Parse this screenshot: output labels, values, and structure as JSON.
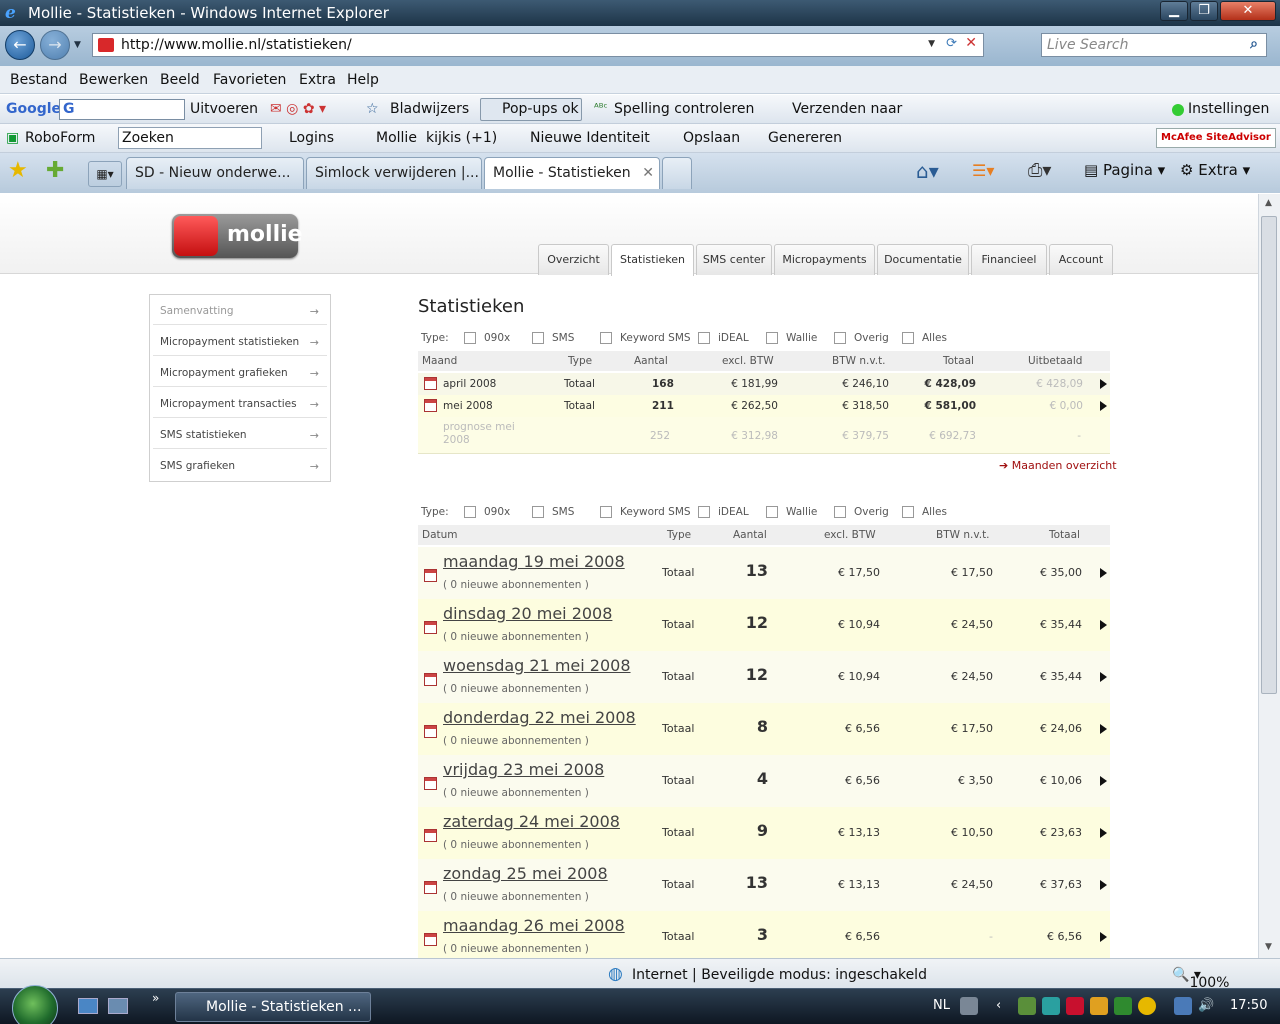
{
  "window": {
    "title": "Mollie - Statistieken - Windows Internet Explorer"
  },
  "address": {
    "url": "http://www.mollie.nl/statistieken/",
    "search_placeholder": "Live Search"
  },
  "menu": [
    "Bestand",
    "Bewerken",
    "Beeld",
    "Favorieten",
    "Extra",
    "Help"
  ],
  "google_toolbar": {
    "brand": "Google",
    "search_engine": "G",
    "run_label": "Uitvoeren",
    "bookmarks_label": "Bladwijzers",
    "popups_label": "Pop-ups ok",
    "spelling_label": "Spelling controleren",
    "send_label": "Verzenden naar",
    "settings_label": "Instellingen"
  },
  "roboform_toolbar": {
    "brand": "RoboForm",
    "search_label": "Zoeken",
    "logins_label": "Logins",
    "mollie_label": "Mollie",
    "kijkis_label": "kijkis (+1)",
    "identity_label": "Nieuwe Identiteit",
    "save_label": "Opslaan",
    "generate_label": "Genereren",
    "mcafee_label": "McAfee SiteAdvisor"
  },
  "tabs": [
    {
      "label": "SD - Nieuw onderwe..."
    },
    {
      "label": "Simlock verwijderen |..."
    },
    {
      "label": "Mollie - Statistieken"
    }
  ],
  "command_bar": {
    "page_label": "Pagina",
    "extra_label": "Extra"
  },
  "site": {
    "logo_text": "mollie",
    "nav": [
      "Overzicht",
      "Statistieken",
      "SMS center",
      "Micropayments",
      "Documentatie",
      "Financieel",
      "Account"
    ],
    "sidebar": [
      "Samenvatting",
      "Micropayment statistieken",
      "Micropayment grafieken",
      "Micropayment transacties",
      "SMS statistieken",
      "SMS grafieken"
    ],
    "page_title": "Statistieken",
    "type_label": "Type:",
    "types": [
      "090x",
      "SMS",
      "Keyword SMS",
      "iDEAL",
      "Wallie",
      "Overig",
      "Alles"
    ],
    "month_table": {
      "headers": {
        "month": "Maand",
        "type": "Type",
        "count": "Aantal",
        "excl": "excl. BTW",
        "btw": "BTW n.v.t.",
        "total": "Totaal",
        "paid": "Uitbetaald"
      },
      "rows": [
        {
          "month": "april 2008",
          "type": "Totaal",
          "count": "168",
          "excl": "€ 181,99",
          "btw": "€ 246,10",
          "total": "€ 428,09",
          "paid": "€ 428,09"
        },
        {
          "month": "mei 2008",
          "type": "Totaal",
          "count": "211",
          "excl": "€ 262,50",
          "btw": "€ 318,50",
          "total": "€ 581,00",
          "paid": "€ 0,00"
        }
      ],
      "forecast": {
        "line1": "prognose mei",
        "line2": "2008",
        "count": "252",
        "excl": "€ 312,98",
        "btw": "€ 379,75",
        "total": "€ 692,73",
        "paid": "-"
      },
      "months_overview_link": "Maanden overzicht"
    },
    "day_table": {
      "headers": {
        "date": "Datum",
        "type": "Type",
        "count": "Aantal",
        "excl": "excl. BTW",
        "btw": "BTW n.v.t.",
        "total": "Totaal"
      },
      "rows": [
        {
          "date": "maandag 19 mei 2008",
          "sub": "( 0 nieuwe abonnementen )",
          "type": "Totaal",
          "count": "13",
          "excl": "€ 17,50",
          "btw": "€ 17,50",
          "total": "€ 35,00"
        },
        {
          "date": "dinsdag 20 mei 2008",
          "sub": "( 0 nieuwe abonnementen )",
          "type": "Totaal",
          "count": "12",
          "excl": "€ 10,94",
          "btw": "€ 24,50",
          "total": "€ 35,44"
        },
        {
          "date": "woensdag 21 mei 2008",
          "sub": "( 0 nieuwe abonnementen )",
          "type": "Totaal",
          "count": "12",
          "excl": "€ 10,94",
          "btw": "€ 24,50",
          "total": "€ 35,44"
        },
        {
          "date": "donderdag 22 mei 2008",
          "sub": "( 0 nieuwe abonnementen )",
          "type": "Totaal",
          "count": "8",
          "excl": "€ 6,56",
          "btw": "€ 17,50",
          "total": "€ 24,06"
        },
        {
          "date": "vrijdag 23 mei 2008",
          "sub": "( 0 nieuwe abonnementen )",
          "type": "Totaal",
          "count": "4",
          "excl": "€ 6,56",
          "btw": "€ 3,50",
          "total": "€ 10,06"
        },
        {
          "date": "zaterdag 24 mei 2008",
          "sub": "( 0 nieuwe abonnementen )",
          "type": "Totaal",
          "count": "9",
          "excl": "€ 13,13",
          "btw": "€ 10,50",
          "total": "€ 23,63"
        },
        {
          "date": "zondag 25 mei 2008",
          "sub": "( 0 nieuwe abonnementen )",
          "type": "Totaal",
          "count": "13",
          "excl": "€ 13,13",
          "btw": "€ 24,50",
          "total": "€ 37,63"
        },
        {
          "date": "maandag 26 mei 2008",
          "sub": "( 0 nieuwe abonnementen )",
          "type": "Totaal",
          "count": "3",
          "excl": "€ 6,56",
          "btw": "-",
          "total": "€ 6,56"
        }
      ]
    }
  },
  "status": {
    "zone": "Internet | Beveiligde modus: ingeschakeld",
    "zoom": "100%"
  },
  "taskbar": {
    "window_button": "Mollie - Statistieken ...",
    "lang": "NL",
    "time": "17:50"
  }
}
